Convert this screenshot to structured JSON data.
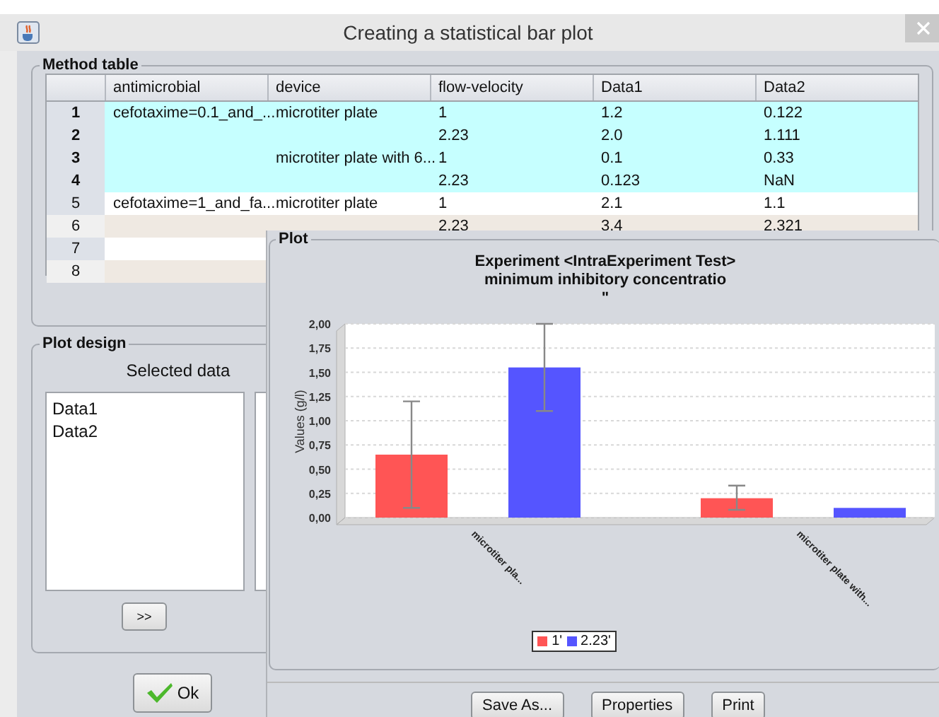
{
  "window": {
    "title": "Creating a statistical bar plot"
  },
  "method_table": {
    "title": "Method table",
    "columns": [
      "antimicrobial",
      "device",
      "flow-velocity",
      "Data1",
      "Data2"
    ],
    "rows": [
      {
        "number": "1",
        "selected": true,
        "cells": [
          "cefotaxime=0.1_and_...",
          "microtiter plate",
          "1",
          "1.2",
          "0.122"
        ]
      },
      {
        "number": "2",
        "selected": true,
        "cells": [
          null,
          null,
          "2.23",
          "2.0",
          "1.111"
        ]
      },
      {
        "number": "3",
        "selected": true,
        "cells": [
          null,
          "microtiter plate with 6...",
          "1",
          "0.1",
          "0.33"
        ]
      },
      {
        "number": "4",
        "selected": true,
        "cells": [
          null,
          null,
          "2.23",
          "0.123",
          "NaN"
        ]
      },
      {
        "number": "5",
        "selected": false,
        "cells": [
          "cefotaxime=1_and_fa...",
          "microtiter plate",
          "1",
          "2.1",
          "1.1"
        ]
      },
      {
        "number": "6",
        "selected": false,
        "cells": [
          null,
          null,
          "2.23",
          "3.4",
          "2.321"
        ]
      },
      {
        "number": "7",
        "selected": false,
        "cells": [
          null,
          null,
          null,
          null,
          null
        ]
      },
      {
        "number": "8",
        "selected": false,
        "cells": [
          null,
          null,
          null,
          null,
          null
        ]
      }
    ]
  },
  "plot_design": {
    "title": "Plot design",
    "heading": "Selected data",
    "items": [
      "Data1",
      "Data2"
    ],
    "move_button": ">>"
  },
  "ok_button": "Ok",
  "plot": {
    "title": "Plot",
    "chart_data": {
      "type": "bar",
      "title": "Experiment <IntraExperiment Test>\nminimum inhibitory concentratio\n\"",
      "ylabel": "Values (g/l)",
      "categories": [
        "microtiter pla...",
        "microtiter plate with..."
      ],
      "series": [
        {
          "name": "1'",
          "color": "#ff5555",
          "values": [
            0.65,
            0.2
          ],
          "errors": [
            [
              0.1,
              1.2
            ],
            [
              0.08,
              0.33
            ]
          ]
        },
        {
          "name": "2.23'",
          "color": "#5555ff",
          "values": [
            1.55,
            0.1
          ],
          "errors": [
            [
              1.1,
              2.0
            ],
            null
          ]
        }
      ],
      "grid": true,
      "ylim": [
        0,
        2
      ],
      "yticks": [
        {
          "value": 0,
          "label": "0,00"
        },
        {
          "value": 0.25,
          "label": "0,25"
        },
        {
          "value": 0.5,
          "label": "0,50"
        },
        {
          "value": 0.75,
          "label": "0,75"
        },
        {
          "value": 1,
          "label": "1,00"
        },
        {
          "value": 1.25,
          "label": "1,25"
        },
        {
          "value": 1.5,
          "label": "1,50"
        },
        {
          "value": 1.75,
          "label": "1,75"
        },
        {
          "value": 2,
          "label": "2,00"
        }
      ]
    },
    "buttons": [
      "Save As...",
      "Properties",
      "Print"
    ]
  }
}
